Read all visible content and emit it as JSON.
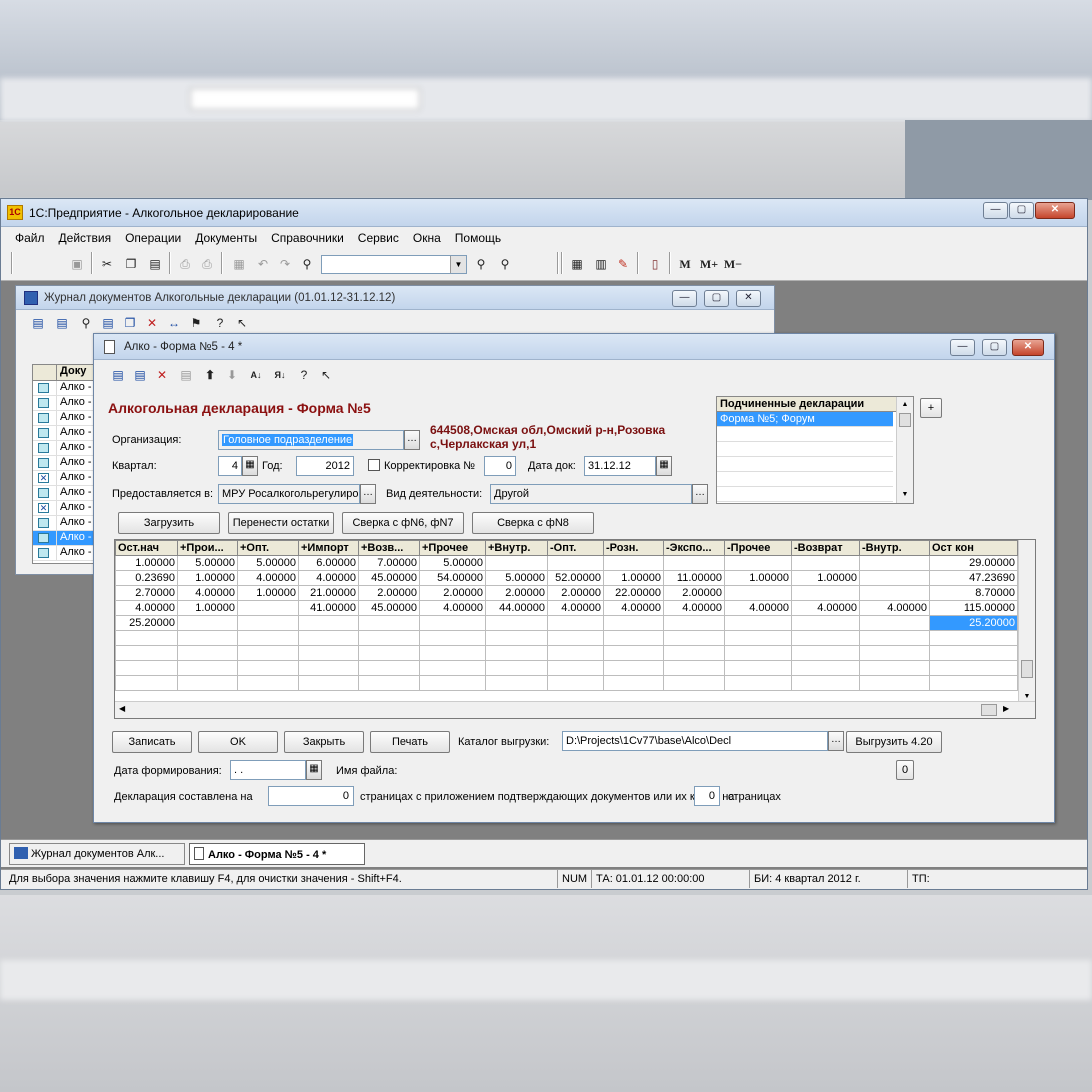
{
  "app": {
    "title": "1С:Предприятие - Алкогольное декларирование",
    "menu": [
      "Файл",
      "Действия",
      "Операции",
      "Документы",
      "Справочники",
      "Сервис",
      "Окна",
      "Помощь"
    ],
    "toolbar": {
      "mem_labels": [
        "M",
        "M+",
        "M−"
      ]
    }
  },
  "journal": {
    "title": "Журнал документов  Алкогольные декларации (01.01.12-31.12.12)",
    "header": "Доку",
    "rows": [
      "Алко -",
      "Алко -",
      "Алко -",
      "Алко -",
      "Алко -",
      "Алко -",
      "Алко -",
      "Алко -",
      "Алко -",
      "Алко -",
      "Алко -",
      "Алко -"
    ]
  },
  "form": {
    "title": "Алко - Форма №5 - 4 *",
    "heading": "Алкогольная декларация -  Форма №5",
    "address": [
      "644508,Омская обл,Омский р-н,Розовка",
      "с,Черлакская ул,1"
    ],
    "org_label": "Организация:",
    "org_value": "Головное подразделение",
    "quarter_label": "Квартал:",
    "quarter_value": "4",
    "year_label": "Год:",
    "year_value": "2012",
    "correction_label": "Корректировка №",
    "correction_value": "0",
    "date_label": "Дата док:",
    "date_value": "31.12.12",
    "provided_label": "Предоставляется в:",
    "provided_value": "МРУ Росалкогольрегулиро",
    "activity_label": "Вид деятельности:",
    "activity_value": "Другой",
    "sub_title": "Подчиненные декларации",
    "sub_items": [
      "Форма №5; Форум"
    ],
    "plus": "+",
    "buttons_top": [
      "Загрузить",
      "Перенести остатки",
      "Сверка с фN6, фN7",
      "Сверка с фN8"
    ],
    "table": {
      "headers": [
        "Ост.нач",
        "+Прои...",
        "+Опт.",
        "+Импорт",
        "+Возв...",
        "+Прочее",
        "+Внутр.",
        "-Опт.",
        "-Розн.",
        "-Экспо...",
        "-Прочее",
        "-Возврат",
        "-Внутр.",
        "Ост кон"
      ],
      "rows": [
        [
          "1.00000",
          "5.00000",
          "5.00000",
          "6.00000",
          "7.00000",
          "5.00000",
          "",
          "",
          "",
          "",
          "",
          "",
          "",
          "29.00000"
        ],
        [
          "0.23690",
          "1.00000",
          "4.00000",
          "4.00000",
          "45.00000",
          "54.00000",
          "5.00000",
          "52.00000",
          "1.00000",
          "11.00000",
          "1.00000",
          "1.00000",
          "",
          "47.23690"
        ],
        [
          "2.70000",
          "4.00000",
          "1.00000",
          "21.00000",
          "2.00000",
          "2.00000",
          "2.00000",
          "2.00000",
          "22.00000",
          "2.00000",
          "",
          "",
          "",
          "8.70000"
        ],
        [
          "4.00000",
          "1.00000",
          "",
          "41.00000",
          "45.00000",
          "4.00000",
          "44.00000",
          "4.00000",
          "4.00000",
          "4.00000",
          "4.00000",
          "4.00000",
          "4.00000",
          "115.00000"
        ],
        [
          "25.20000",
          "",
          "",
          "",
          "",
          "",
          "",
          "",
          "",
          "",
          "",
          "",
          "",
          "25.20000"
        ]
      ]
    },
    "buttons_bottom": [
      "Записать",
      "OK",
      "Закрыть",
      "Печать"
    ],
    "catalog_label": "Каталог выгрузки:",
    "catalog_value": "D:\\Projects\\1Cv77\\base\\Alco\\Decl",
    "export_button": "Выгрузить 4.20",
    "formdate_label": "Дата формирования:",
    "formdate_value": " .  .",
    "filename_label": "Имя файла:",
    "filename_btn": "0",
    "pages_label1": "Декларация составлена на",
    "pages_value1": "0",
    "pages_label2": "страницах с приложением подтверждающих документов или их копий на",
    "pages_value2": "0",
    "pages_label3": "страницах"
  },
  "taskbar": [
    "Журнал документов  Алк...",
    "Алко - Форма №5 - 4 *"
  ],
  "status": {
    "hint": "Для выбора значения нажмите клавишу F4, для очистки значения - Shift+F4.",
    "num": "NUM",
    "ta": "ТА: 01.01.12  00:00:00",
    "bi": "БИ: 4 квартал 2012 г.",
    "tp": "ТП:"
  }
}
